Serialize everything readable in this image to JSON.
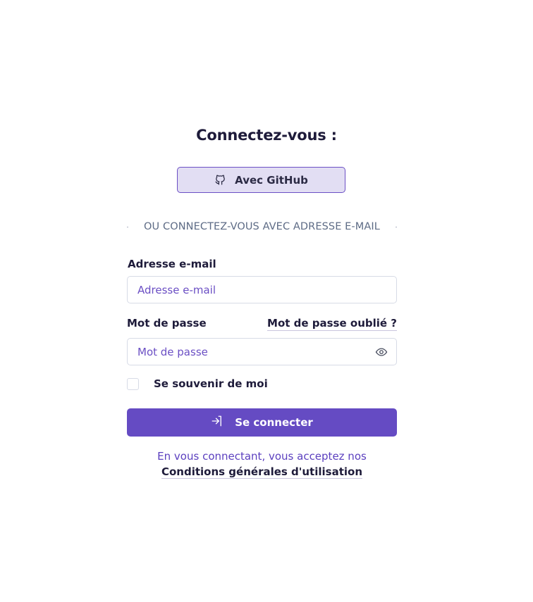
{
  "login": {
    "title": "Connectez-vous :",
    "github_label": "Avec GitHub",
    "divider_text": "OU CONNECTEZ-VOUS AVEC ADRESSE E-MAIL",
    "email_label": "Adresse e-mail",
    "email_placeholder": "Adresse e-mail",
    "password_label": "Mot de passe",
    "forgot_label": "Mot de passe oublié ?",
    "password_placeholder": "Mot de passe",
    "remember_label": "Se souvenir de moi",
    "submit_label": "Se connecter",
    "terms_prefix": "En vous connectant, vous acceptez nos ",
    "terms_link": "Conditions générales d'utilisation"
  },
  "colors": {
    "accent": "#654bc3",
    "github_bg": "#e2def3",
    "text_dark": "#1e1b3a",
    "placeholder": "#6b4fc4"
  },
  "icons": {
    "github": "github-icon",
    "eye": "eye-icon",
    "login": "login-arrow-icon"
  }
}
